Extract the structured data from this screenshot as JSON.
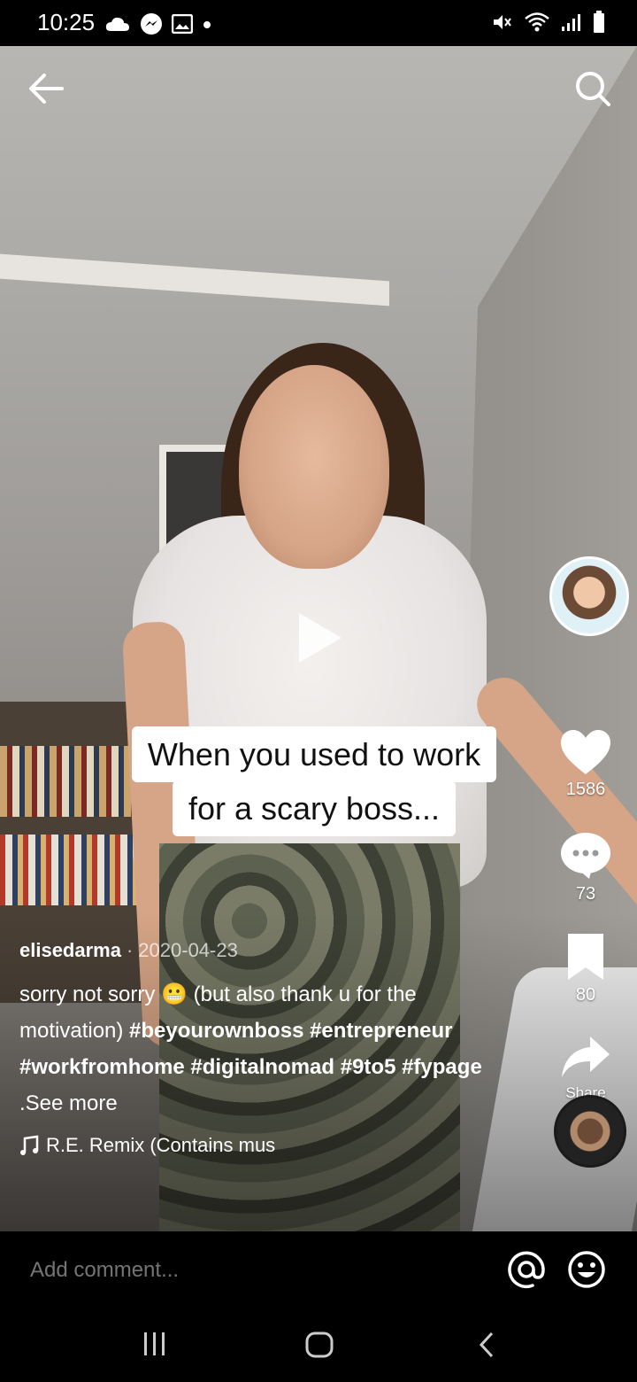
{
  "status_bar": {
    "time": "10:25",
    "left_icons": [
      "cloud-icon",
      "messenger-icon",
      "image-icon",
      "dot-icon"
    ],
    "right_icons": [
      "mute-icon",
      "wifi-icon",
      "signal-icon",
      "battery-icon"
    ]
  },
  "video": {
    "caption_line1": "When you used to work",
    "caption_line2": "for a scary boss..."
  },
  "rail": {
    "likes": "1586",
    "comments": "73",
    "saves": "80",
    "share_label": "Share"
  },
  "post": {
    "author": "elisedarma",
    "separator": "·",
    "date": "2020-04-23",
    "text_start": "sorry not sorry",
    "emoji": "😬",
    "text_end": "(but also thank u for the motivation)",
    "hashtags": "#beyourownboss #entrepreneur #workfromhome #digitalnomad #9to5 #fypage",
    "see_more": ".See more",
    "music": "R.E. Remix (Contains mus"
  },
  "comment": {
    "placeholder": "Add comment..."
  }
}
